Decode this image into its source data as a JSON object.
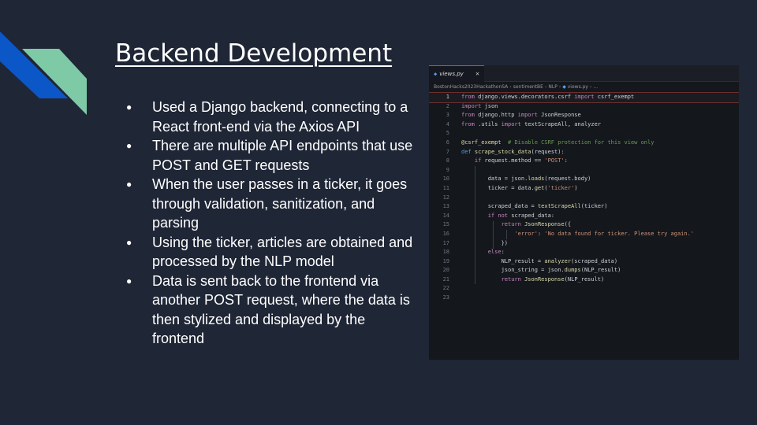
{
  "slide": {
    "title": "Backend Development",
    "bullets": [
      "Used  a Django backend, connecting to a React front-end via the Axios API",
      "There are multiple API endpoints that use POST and GET requests",
      "When the user passes in a ticker, it goes through validation, sanitization, and parsing",
      "Using the ticker, articles are obtained and processed by the NLP model",
      "Data is sent back to the frontend via another POST request, where the data is then stylized and displayed by the frontend"
    ]
  },
  "editor": {
    "tab": {
      "icon": "python-file-icon",
      "label": "views.py",
      "close": "✕"
    },
    "breadcrumb": [
      "BostonHacks2023HackathonSA",
      "sentimentBE",
      "NLP",
      "views.py",
      "..."
    ],
    "line_numbers": [
      "1",
      "2",
      "3",
      "4",
      "5",
      "6",
      "7",
      "8",
      "9",
      "10",
      "11",
      "12",
      "13",
      "14",
      "15",
      "16",
      "17",
      "18",
      "19",
      "20",
      "21",
      "22",
      "23"
    ]
  },
  "colors": {
    "background": "#1f2636",
    "deco_blue": "#0b57c8",
    "deco_green": "#7ec9a6",
    "editor_bg": "#14171c",
    "keyword": "#c586c0",
    "string": "#ce9178",
    "comment": "#6a9955"
  }
}
